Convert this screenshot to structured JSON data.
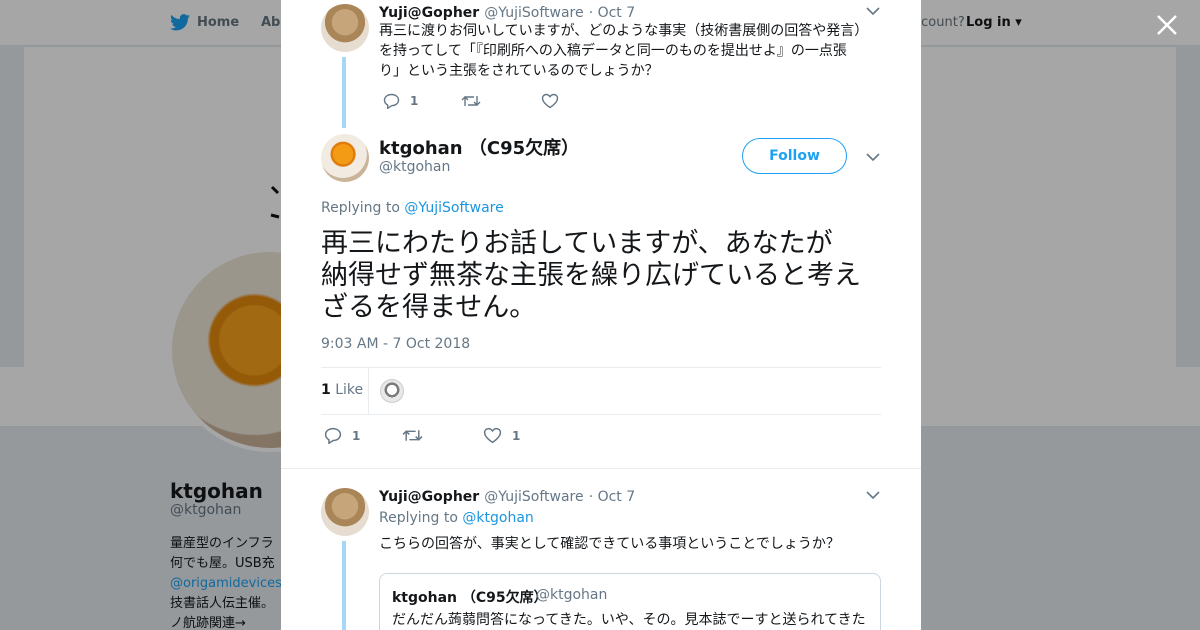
{
  "background": {
    "nav": {
      "home_label": "Home",
      "about_label": "Abo",
      "account_text": "ccount?",
      "login_label": "Log in"
    },
    "profile": {
      "name": "ktgohan （C",
      "handle": "@ktgohan",
      "bio_lines": [
        "量産型のインフラ",
        "何でも屋。USB充",
        "@origamidevices",
        "技書話人伝主催。",
        "ノ航跡関連→"
      ]
    }
  },
  "tweets": {
    "parent": {
      "name": "Yuji@Gopher",
      "handle": "@YujiSoftware",
      "date": "· Oct 7",
      "text_lines": [
        "再三に渡りお伺いしていますが、どのような事実（技術書展側の回答や発言）",
        "を持ってして「『印刷所への入稿データと同一のものを提出せよ』の一点張",
        "り」という主張をされているのでしょうか？"
      ],
      "reply_count": "1"
    },
    "main": {
      "name": "ktgohan （C95欠席）",
      "handle": "@ktgohan",
      "follow_label": "Follow",
      "replying_prefix": "Replying to",
      "replying_to": "@YujiSoftware",
      "text_lines": [
        "再三にわたりお話していますが、あなたが",
        "納得せず無茶な主張を繰り広げていると考え",
        "ざるを得ません。"
      ],
      "timestamp": "9:03 AM - 7 Oct 2018",
      "like_count": "1",
      "like_label": "Like",
      "reply_count": "1",
      "action_like_count": "1"
    },
    "reply": {
      "name": "Yuji@Gopher",
      "handle": "@YujiSoftware",
      "date": "· Oct 7",
      "replying_prefix": "Replying to",
      "replying_to": "@ktgohan",
      "text": "こちらの回答が、事実として確認できている事項ということでしょうか？",
      "quote": {
        "name": "ktgohan （C95欠席）",
        "handle": "@ktgohan",
        "text": "だんだん蒟蒻問答になってきた。いや、その。見本誌でーすと送られてきた"
      }
    }
  },
  "colors": {
    "accent": "#1da1f2",
    "thread_line": "#a6d8f5",
    "muted": "#657786"
  }
}
